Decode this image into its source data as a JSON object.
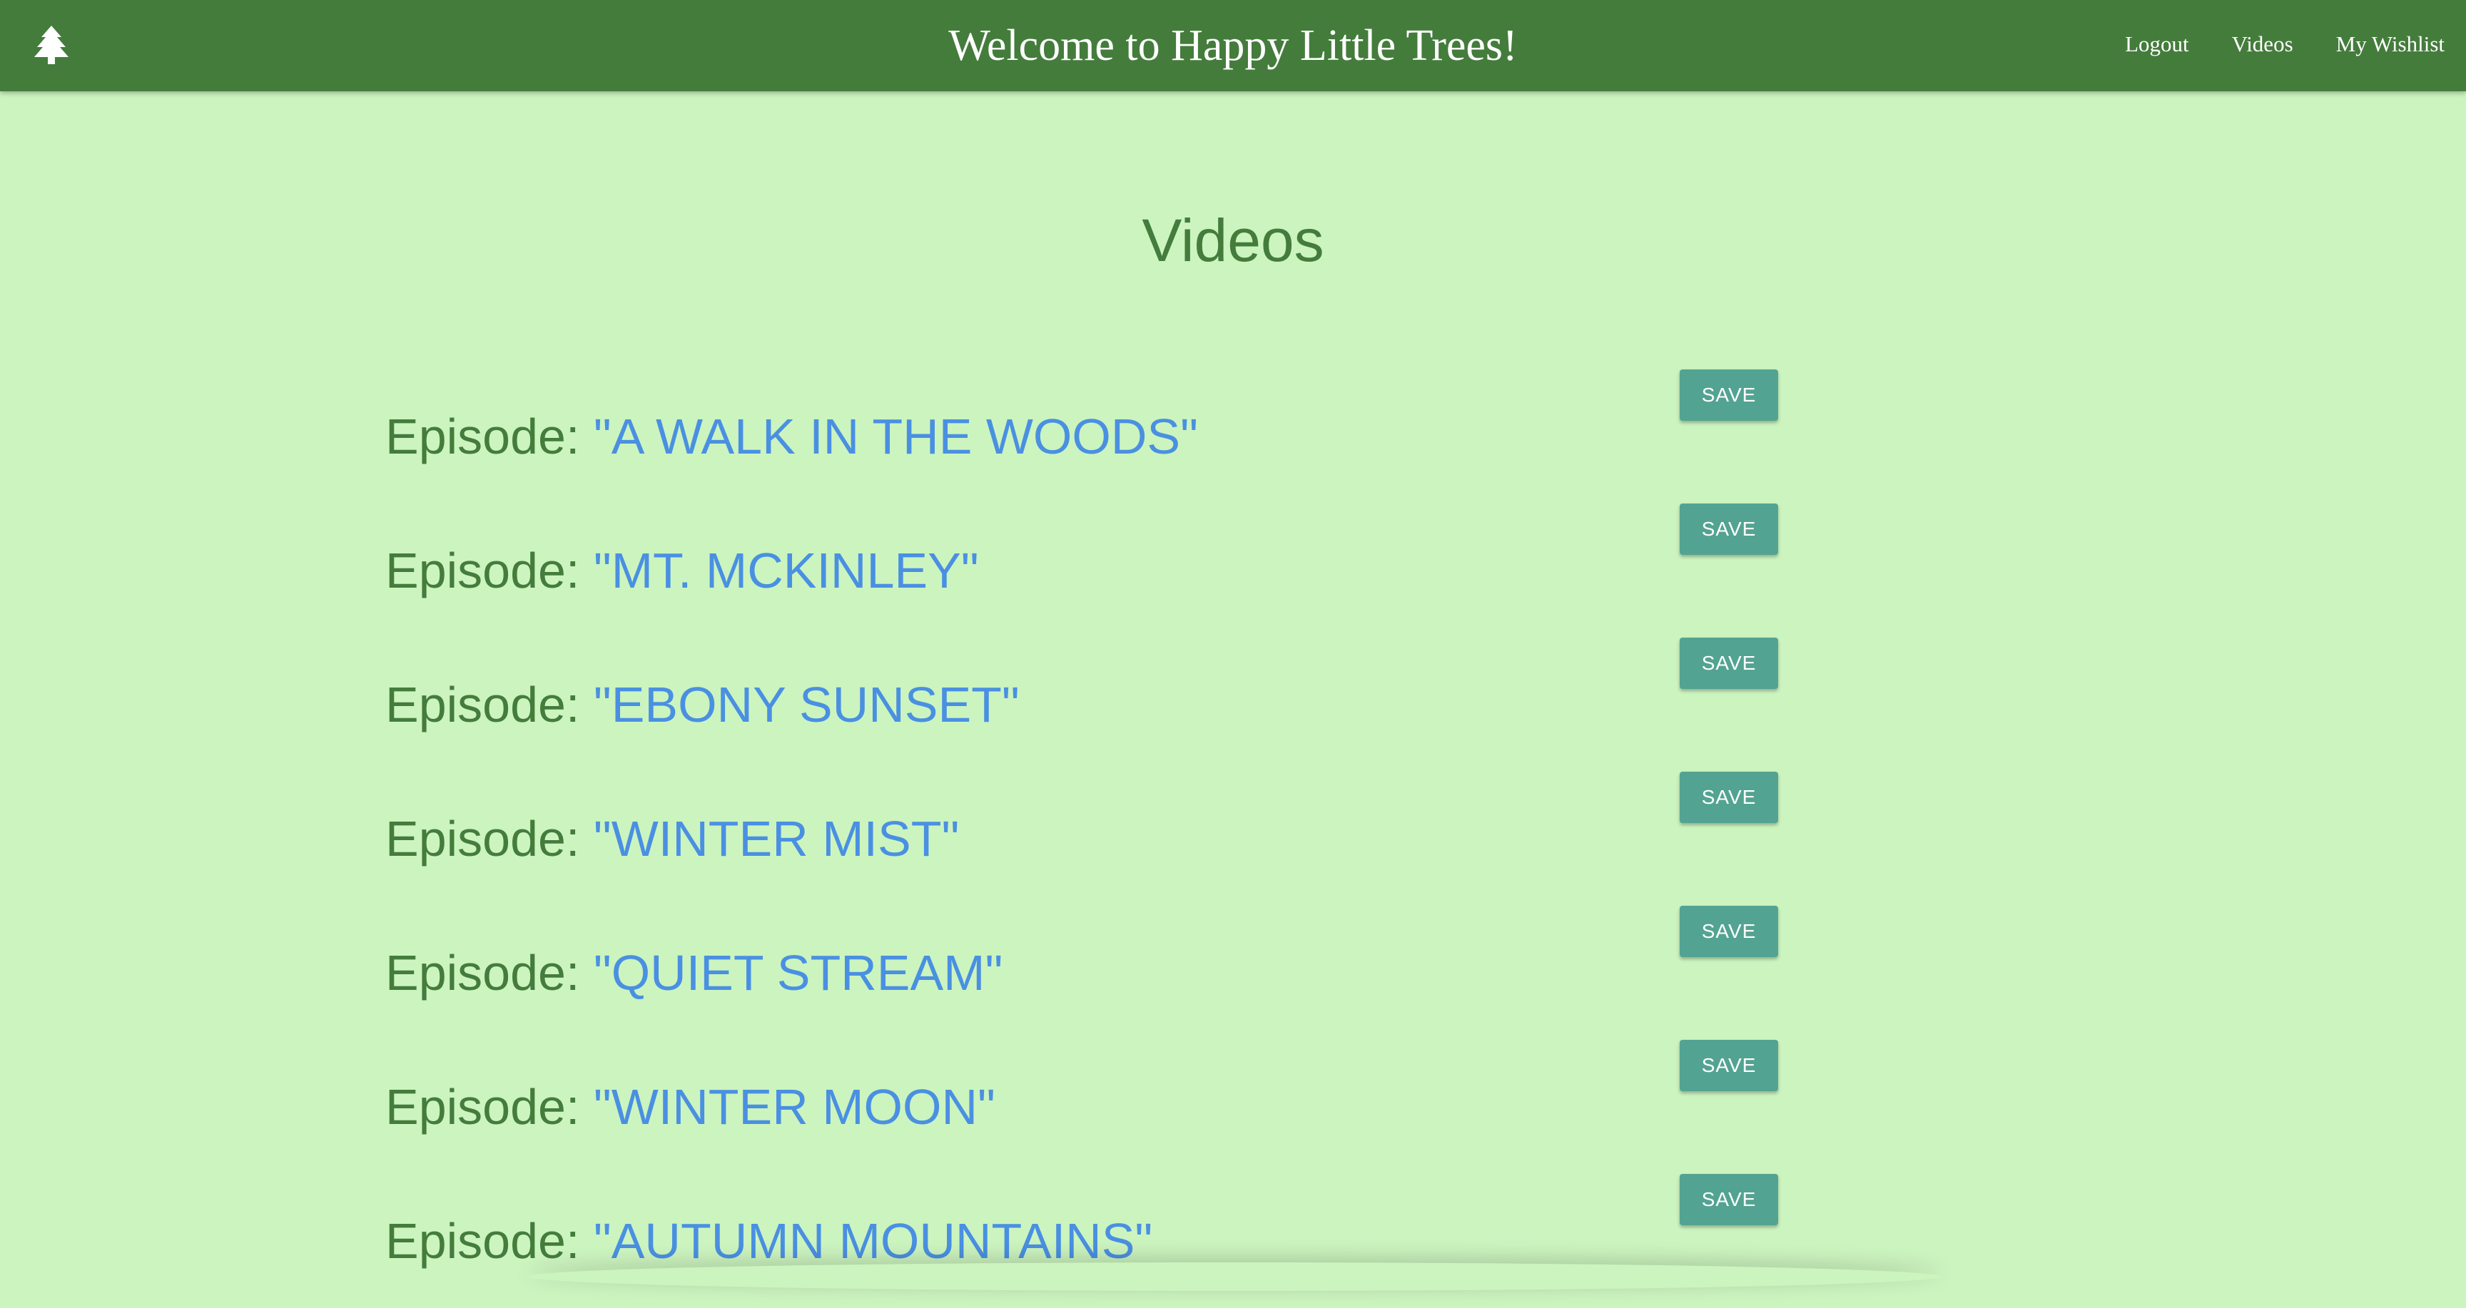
{
  "navbar": {
    "logo_icon": "tree-icon",
    "title": "Welcome to Happy Little Trees!",
    "links": [
      "Logout",
      "Videos",
      "My Wishlist"
    ],
    "background": "#447c3c"
  },
  "page": {
    "heading": "Videos",
    "background": "#ccf4bf"
  },
  "colors": {
    "episode_label": "#447c3c",
    "episode_name": "#4a90e2",
    "save_button": "#53a392"
  },
  "videos": [
    {
      "prefix": "Episode: ",
      "name": "\"A WALK IN THE WOODS\"",
      "button": "SAVE"
    },
    {
      "prefix": "Episode: ",
      "name": "\"MT. MCKINLEY\"",
      "button": "SAVE"
    },
    {
      "prefix": "Episode: ",
      "name": "\"EBONY SUNSET\"",
      "button": "SAVE"
    },
    {
      "prefix": "Episode: ",
      "name": "\"WINTER MIST\"",
      "button": "SAVE"
    },
    {
      "prefix": "Episode: ",
      "name": "\"QUIET STREAM\"",
      "button": "SAVE"
    },
    {
      "prefix": "Episode: ",
      "name": "\"WINTER MOON\"",
      "button": "SAVE"
    },
    {
      "prefix": "Episode: ",
      "name": "\"AUTUMN MOUNTAINS\"",
      "button": "SAVE"
    }
  ]
}
